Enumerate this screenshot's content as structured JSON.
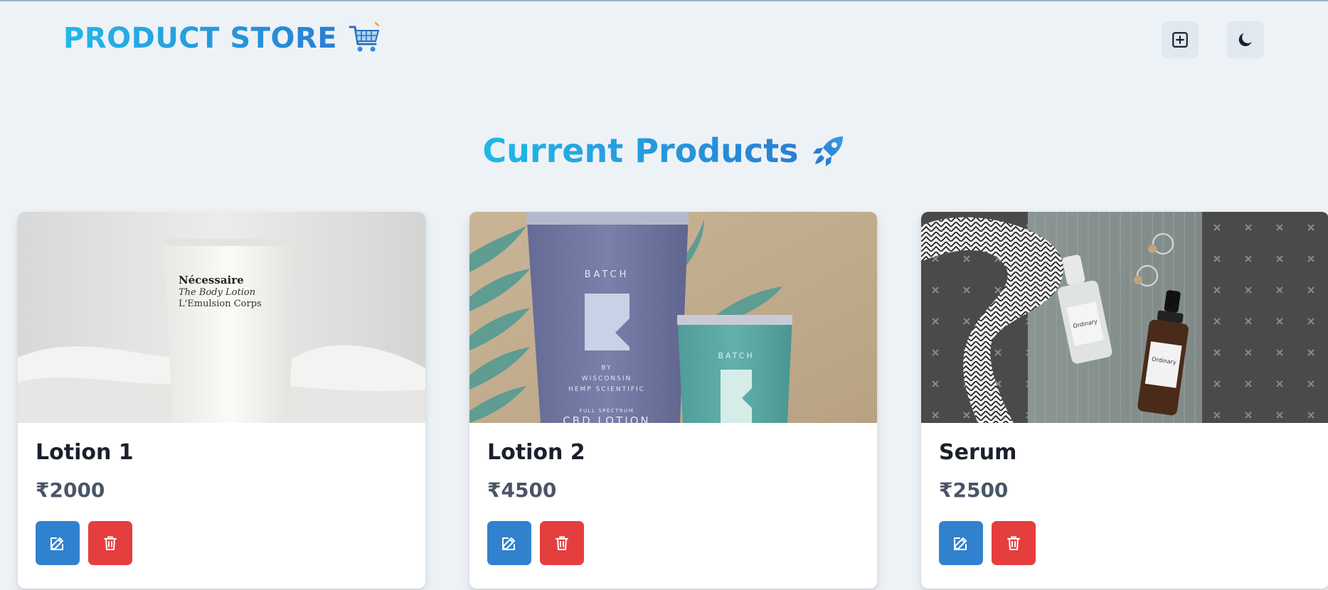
{
  "header": {
    "brand": "PRODUCT STORE",
    "brand_icon": "shopping-cart-icon",
    "actions": [
      {
        "name": "create-product-button",
        "icon": "plus-square-icon"
      },
      {
        "name": "theme-toggle-button",
        "icon": "moon-icon"
      }
    ]
  },
  "main": {
    "heading": "Current Products",
    "heading_icon": "rocket-icon"
  },
  "products": [
    {
      "name": "Lotion 1",
      "price": "₹2000",
      "image_alt": "Nécessaire The Body Lotion L'Emulsion Corps",
      "image_label_lines": [
        "Nécessaire",
        "The Body Lotion",
        "L'Emulsion Corps"
      ]
    },
    {
      "name": "Lotion 2",
      "price": "₹4500",
      "image_alt": "BATCH by Wisconsin Hemp Scientific CBD Lotion",
      "image_label_lines": [
        "BATCH",
        "BY",
        "WISCONSIN",
        "HEMP SCIENTIFIC",
        "FULL SPECTRUM",
        "CBD LOTION"
      ]
    },
    {
      "name": "Serum",
      "price": "₹2500",
      "image_alt": "The Ordinary serum bottles",
      "image_label_lines": [
        "Ordinary",
        "Ordinary"
      ]
    }
  ],
  "colors": {
    "brand_gradient_start": "#22b8e8",
    "brand_gradient_end": "#2a7fd3",
    "edit": "#3182ce",
    "delete": "#e53e3e",
    "background": "#edf2f7"
  }
}
